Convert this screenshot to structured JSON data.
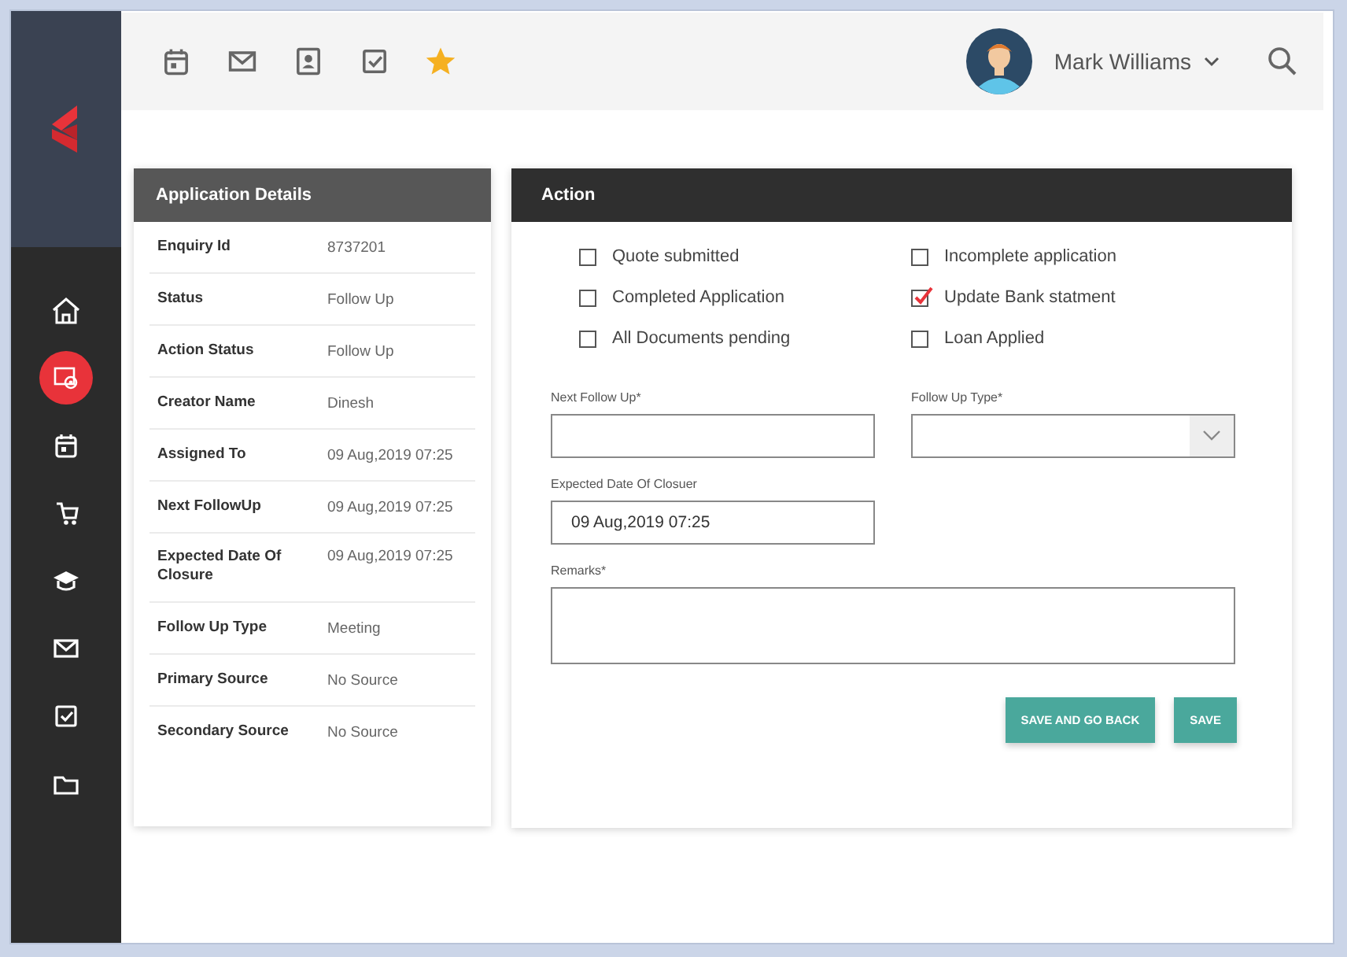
{
  "sidebar": {
    "items": [
      {
        "kind": "home",
        "selected": false
      },
      {
        "kind": "settings",
        "selected": true
      },
      {
        "kind": "calendar",
        "selected": false
      },
      {
        "kind": "cart",
        "selected": false
      },
      {
        "kind": "education",
        "selected": false
      },
      {
        "kind": "mail",
        "selected": false
      },
      {
        "kind": "tasks",
        "selected": false
      },
      {
        "kind": "folder",
        "selected": false
      }
    ]
  },
  "toolbar": {
    "items": [
      {
        "kind": "calendar"
      },
      {
        "kind": "mail"
      },
      {
        "kind": "contact"
      },
      {
        "kind": "tasks"
      },
      {
        "kind": "star"
      }
    ]
  },
  "user": {
    "name": "Mark Williams"
  },
  "details": {
    "title": "Application Details",
    "rows": [
      {
        "label": "Enquiry Id",
        "value": "8737201"
      },
      {
        "label": "Status",
        "value": "Follow Up"
      },
      {
        "label": "Action Status",
        "value": "Follow Up"
      },
      {
        "label": "Creator Name",
        "value": "Dinesh"
      },
      {
        "label": "Assigned To",
        "value": "09 Aug,2019 07:25"
      },
      {
        "label": "Next FollowUp",
        "value": "09 Aug,2019 07:25"
      },
      {
        "label": "Expected Date Of Closure",
        "value": "09 Aug,2019 07:25"
      },
      {
        "label": "Follow Up Type",
        "value": "Meeting"
      },
      {
        "label": "Primary Source",
        "value": "No Source"
      },
      {
        "label": "Secondary Source",
        "value": "No Source"
      }
    ]
  },
  "action": {
    "title": "Action",
    "checkboxes": [
      {
        "label": "Quote submitted",
        "checked": false
      },
      {
        "label": "Incomplete application",
        "checked": false
      },
      {
        "label": "Completed Application",
        "checked": false
      },
      {
        "label": "Update Bank statment",
        "checked": true
      },
      {
        "label": "All Documents pending",
        "checked": false
      },
      {
        "label": "Loan Applied",
        "checked": false
      }
    ],
    "fields": [
      {
        "kind": "text",
        "label": "Next Follow Up*"
      },
      {
        "kind": "select",
        "label": "Follow Up Type*"
      },
      {
        "kind": "text",
        "label": "Expected Date Of Closuer",
        "value": "09 Aug,2019 07:25"
      },
      {
        "kind": "textarea",
        "label": "Remarks*"
      }
    ],
    "buttons": [
      "SAVE AND GO BACK",
      "SAVE"
    ]
  }
}
